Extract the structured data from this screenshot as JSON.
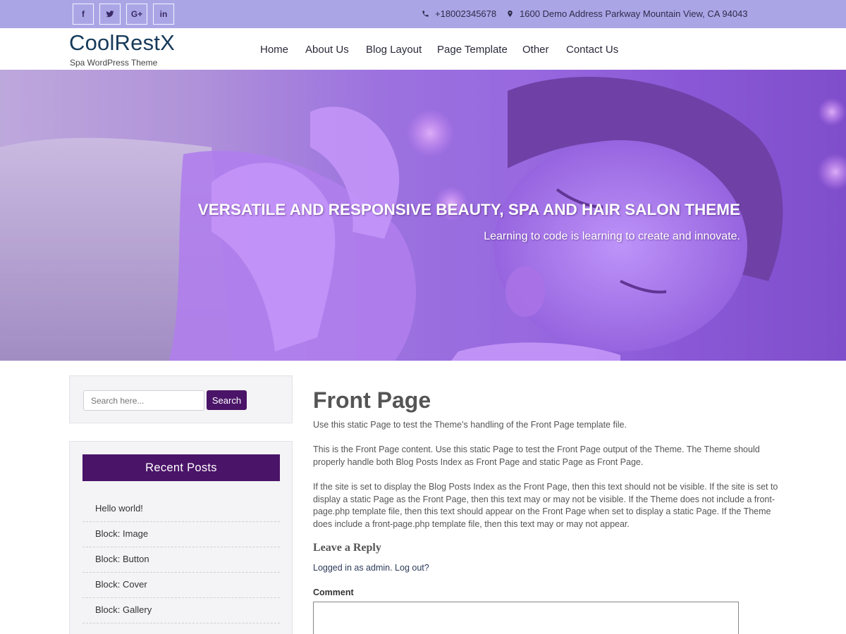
{
  "topbar": {
    "social": [
      {
        "icon": "facebook-icon",
        "glyph": "f"
      },
      {
        "icon": "twitter-icon",
        "glyph": ""
      },
      {
        "icon": "google-plus-icon",
        "glyph": "G+"
      },
      {
        "icon": "linkedin-icon",
        "glyph": "in"
      }
    ],
    "phone": "+18002345678",
    "address": "1600 Demo Address Parkway Mountain View, CA 94043",
    "background": "#aaa6e6"
  },
  "header": {
    "site_title": "CoolRestX",
    "tagline": "Spa WordPress Theme",
    "nav": [
      "Home",
      "About Us",
      "Blog Layout",
      "Page Template",
      "Other",
      "Contact Us"
    ]
  },
  "hero": {
    "title": "VERSATILE AND RESPONSIVE BEAUTY, SPA AND HAIR SALON THEME",
    "subtitle": "Learning to code is learning to create and innovate."
  },
  "sidebar": {
    "search": {
      "placeholder": "Search here...",
      "button": "Search"
    },
    "recent_posts": {
      "title": "Recent Posts",
      "items": [
        "Hello world!",
        "Block: Image",
        "Block: Button",
        "Block: Cover",
        "Block: Gallery"
      ]
    },
    "accent": "#4a1468"
  },
  "main": {
    "title": "Front Page",
    "paragraphs": [
      "Use this static Page to test the Theme’s handling of the Front Page template file.",
      "This is the Front Page content. Use this static Page to test the Front Page output of the Theme. The Theme should properly handle both Blog Posts Index as Front Page and static Page as Front Page.",
      "If the site is set to display the Blog Posts Index as the Front Page, then this text should not be visible. If the site is set to display a static Page as the Front Page, then this text may or may not be visible. If the Theme does not include a front-page.php template file, then this text should appear on the Front Page when set to display a static Page. If the Theme does include a front-page.php template file, then this text may or may not appear."
    ],
    "reply": {
      "title": "Leave a Reply",
      "logged_in": "Logged in as admin. Log out?",
      "comment_label": "Comment"
    }
  }
}
